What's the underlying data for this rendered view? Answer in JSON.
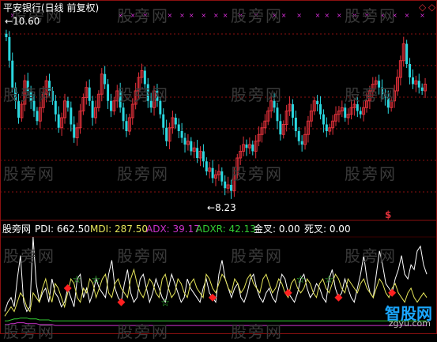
{
  "header": {
    "title": "平安银行(日线 前复权)",
    "high_label": "10.60",
    "low_label": "8.23",
    "dollar_mark": "$"
  },
  "indicator": {
    "name": "股旁网",
    "pdi_label": "PDI: 662.50",
    "mdi_label": "MDI: 287.50",
    "adx_label": "ADX: 39.17",
    "adxr_label": "ADXR: 42.13",
    "jincha_label": "金叉: 0.00",
    "sicha_label": "死叉: 0.00"
  },
  "watermark_text": "股旁网",
  "logo": {
    "main": "智股网",
    "sub": "zgyu.com"
  },
  "colors": {
    "up": "#e0303a",
    "down": "#2ad8e0",
    "pdi": "#ffffff",
    "mdi": "#e6e65a",
    "adx": "#cc33cc",
    "adxr": "#33cc33",
    "grid": "#8b1010",
    "mark": "#e030e0"
  },
  "chart_data": [
    {
      "type": "candlestick",
      "title": "平安银行(日线 前复权)",
      "annotations": [
        "10.60",
        "8.23"
      ],
      "ylim": [
        7.95,
        10.75
      ],
      "closes": [
        10.55,
        10.2,
        9.8,
        9.6,
        9.35,
        9.55,
        9.9,
        9.75,
        9.6,
        9.45,
        9.3,
        9.5,
        9.7,
        9.9,
        9.75,
        9.6,
        9.4,
        9.2,
        9.35,
        9.6,
        9.5,
        9.25,
        9.05,
        9.2,
        9.45,
        9.65,
        9.8,
        9.6,
        9.35,
        9.5,
        9.7,
        10.0,
        9.85,
        9.6,
        9.45,
        9.6,
        9.75,
        9.5,
        9.3,
        9.15,
        9.35,
        9.55,
        9.75,
        9.95,
        10.05,
        9.85,
        9.6,
        9.5,
        9.75,
        9.6,
        9.4,
        9.2,
        9.0,
        9.2,
        9.35,
        9.25,
        9.15,
        9.05,
        8.95,
        9.0,
        8.85,
        8.9,
        8.75,
        8.85,
        8.7,
        8.55,
        8.6,
        8.45,
        8.5,
        8.55,
        8.4,
        8.3,
        8.35,
        8.26,
        8.5,
        8.75,
        8.85,
        8.95,
        8.9,
        8.95,
        8.85,
        9.0,
        9.1,
        9.2,
        9.3,
        9.45,
        9.6,
        9.5,
        9.3,
        9.1,
        9.25,
        9.45,
        9.55,
        9.35,
        9.15,
        9.0,
        8.95,
        9.1,
        9.3,
        9.45,
        9.6,
        9.55,
        9.4,
        9.25,
        9.15,
        9.2,
        9.3,
        9.4,
        9.45,
        9.5,
        9.35,
        9.4,
        9.5,
        9.55,
        9.45,
        9.4,
        9.5,
        9.6,
        9.75,
        9.85,
        9.9,
        9.8,
        9.7,
        9.65,
        9.5,
        9.6,
        9.75,
        9.95,
        10.2,
        10.45,
        10.15,
        9.95,
        9.85,
        9.9,
        9.8,
        9.75,
        9.85
      ],
      "high_marker": "10.60",
      "low_marker": "8.23"
    },
    {
      "type": "line",
      "title": "股旁网",
      "series": [
        {
          "name": "PDI",
          "values": [
            20,
            30,
            35,
            25,
            55,
            80,
            30,
            20,
            25,
            100,
            50,
            30,
            40,
            45,
            30,
            55,
            40,
            35,
            25,
            30,
            45,
            35,
            25,
            55,
            60,
            35,
            45,
            30,
            40,
            55,
            45,
            40,
            35,
            60,
            75,
            45,
            35,
            30,
            50,
            65,
            40,
            30,
            35,
            55,
            60,
            45,
            30,
            40,
            55,
            45,
            35,
            30,
            45,
            60,
            50,
            40,
            30,
            35,
            55,
            45,
            40,
            35,
            30,
            45,
            55,
            40,
            35,
            30,
            60,
            75,
            55,
            45,
            35,
            45,
            50,
            35,
            30,
            40,
            55,
            60,
            45,
            35,
            30,
            40,
            45,
            35,
            30,
            45,
            60,
            55,
            40,
            35,
            30,
            40,
            55,
            60,
            45,
            35,
            40,
            50,
            45,
            35,
            30,
            55,
            65,
            45,
            35,
            40,
            55,
            45,
            35,
            30,
            45,
            60,
            80,
            55,
            40,
            35,
            60,
            85,
            70,
            50,
            45,
            40,
            55,
            65,
            80,
            60,
            55,
            70,
            65,
            85,
            90,
            70,
            60
          ]
        },
        {
          "name": "MDI",
          "values": [
            15,
            20,
            25,
            20,
            30,
            40,
            35,
            25,
            20,
            40,
            35,
            30,
            45,
            55,
            40,
            30,
            50,
            45,
            35,
            25,
            40,
            55,
            50,
            35,
            30,
            45,
            40,
            55,
            50,
            35,
            45,
            55,
            60,
            40,
            35,
            50,
            55,
            45,
            40,
            35,
            55,
            65,
            50,
            40,
            35,
            45,
            55,
            50,
            40,
            35,
            55,
            60,
            45,
            35,
            40,
            55,
            50,
            40,
            35,
            50,
            55,
            45,
            40,
            35,
            60,
            55,
            45,
            40,
            50,
            60,
            55,
            45,
            40,
            55,
            50,
            40,
            45,
            55,
            60,
            50,
            45,
            40,
            55,
            60,
            50,
            40,
            45,
            55,
            50,
            40,
            35,
            50,
            55,
            45,
            40,
            45,
            55,
            50,
            40,
            35,
            50,
            55,
            45,
            40,
            50,
            60,
            55,
            45,
            40,
            55,
            50,
            45,
            40,
            50,
            55,
            45,
            40,
            35,
            45,
            55,
            50,
            40,
            35,
            45,
            50,
            40,
            35,
            30,
            40,
            45,
            35,
            30,
            35,
            40,
            35
          ]
        },
        {
          "name": "ADX",
          "values": [
            6,
            6,
            7,
            7,
            8,
            8,
            8,
            7,
            7,
            7,
            7,
            6,
            6,
            6,
            6,
            6,
            5,
            5,
            5,
            5,
            5,
            5,
            5,
            5,
            5,
            5,
            5,
            5,
            5,
            5,
            5,
            5,
            5,
            5,
            5,
            5,
            5,
            5,
            5,
            5,
            5,
            5,
            5,
            5,
            5,
            5,
            5,
            5,
            5,
            5,
            5,
            5,
            5,
            5,
            5,
            5,
            5,
            5,
            5,
            5,
            5,
            5,
            5,
            5,
            5,
            5,
            5,
            5,
            5,
            5,
            5,
            5,
            5,
            5,
            5,
            5,
            5,
            5,
            5,
            5,
            5,
            5,
            5,
            5,
            5,
            5,
            5,
            5,
            5,
            5,
            5,
            5,
            5,
            5,
            5,
            5,
            5,
            5,
            5,
            5,
            5,
            5,
            5,
            5,
            5,
            5,
            5,
            5,
            5,
            5,
            5,
            5,
            5,
            5,
            5,
            5,
            5,
            5,
            5,
            5,
            5,
            5,
            5,
            5,
            5,
            5,
            5,
            5,
            5,
            5,
            5,
            5,
            5,
            5,
            5
          ]
        },
        {
          "name": "ADXR",
          "values": [
            10,
            10,
            11,
            12,
            12,
            13,
            13,
            13,
            12,
            12,
            12,
            11,
            11,
            11,
            11,
            10,
            10,
            10,
            10,
            10,
            10,
            10,
            10,
            10,
            10,
            10,
            10,
            10,
            10,
            10,
            10,
            10,
            10,
            10,
            10,
            10,
            10,
            10,
            10,
            10,
            10,
            10,
            10,
            10,
            10,
            10,
            10,
            10,
            10,
            10,
            10,
            10,
            10,
            10,
            10,
            10,
            10,
            10,
            10,
            10,
            10,
            10,
            10,
            10,
            10,
            10,
            10,
            10,
            10,
            10,
            10,
            10,
            10,
            10,
            10,
            10,
            10,
            10,
            10,
            10,
            10,
            10,
            10,
            10,
            10,
            10,
            10,
            10,
            10,
            10,
            10,
            10,
            10,
            10,
            10,
            10,
            10,
            10,
            10,
            10,
            10,
            10,
            10,
            10,
            10,
            10,
            10,
            10,
            10,
            10,
            10,
            10,
            10,
            10,
            10,
            10,
            10,
            10,
            10,
            10,
            10,
            10,
            10,
            10,
            10,
            10,
            10,
            10,
            10,
            10,
            10,
            10,
            10,
            10,
            10
          ]
        }
      ],
      "labels": [
        "PDI: 662.50",
        "MDI: 287.50",
        "ADX: 39.17",
        "ADXR: 42.13",
        "金叉: 0.00",
        "死叉: 0.00"
      ],
      "golden_cross_at": [
        23,
        29,
        51,
        94,
        103
      ],
      "death_cross_at": [
        20,
        37,
        66,
        90,
        106,
        123
      ]
    }
  ]
}
